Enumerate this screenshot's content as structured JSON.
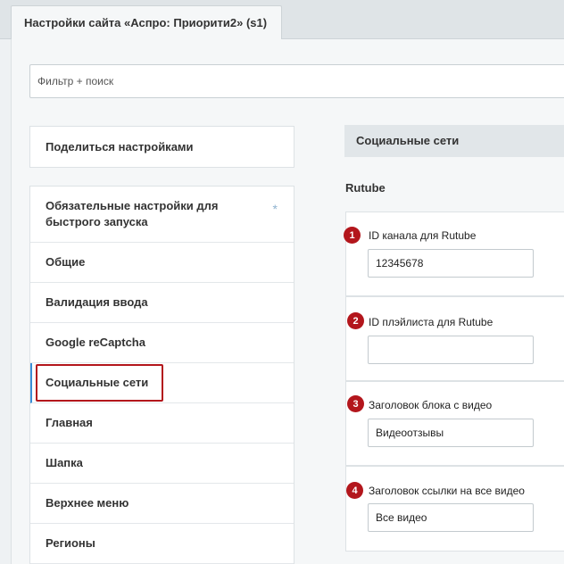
{
  "tab": {
    "title": "Настройки сайта «Аспро: Приорити2» (s1)"
  },
  "filter": {
    "placeholder": "Фильтр + поиск"
  },
  "share": {
    "label": "Поделиться настройками"
  },
  "menu": {
    "items": [
      {
        "label": "Обязательные настройки для быстрого запуска",
        "marker": "*"
      },
      {
        "label": "Общие"
      },
      {
        "label": "Валидация ввода"
      },
      {
        "label": "Google reCaptcha"
      },
      {
        "label": "Социальные сети",
        "active": true
      },
      {
        "label": "Главная"
      },
      {
        "label": "Шапка"
      },
      {
        "label": "Верхнее меню"
      },
      {
        "label": "Регионы"
      }
    ]
  },
  "section": {
    "title": "Социальные сети",
    "subtitle": "Rutube",
    "fields": [
      {
        "badge": "1",
        "label": "ID канала для Rutube",
        "value": "12345678"
      },
      {
        "badge": "2",
        "label": "ID плэйлиста для Rutube",
        "value": ""
      },
      {
        "badge": "3",
        "label": "Заголовок блока с видео",
        "value": "Видеоотзывы"
      },
      {
        "badge": "4",
        "label": "Заголовок ссылки на все видео",
        "value": "Все видео"
      }
    ]
  },
  "colors": {
    "highlight": "#b3161c",
    "badge": "#b3161c",
    "active_marker": "#3a8ed6"
  }
}
